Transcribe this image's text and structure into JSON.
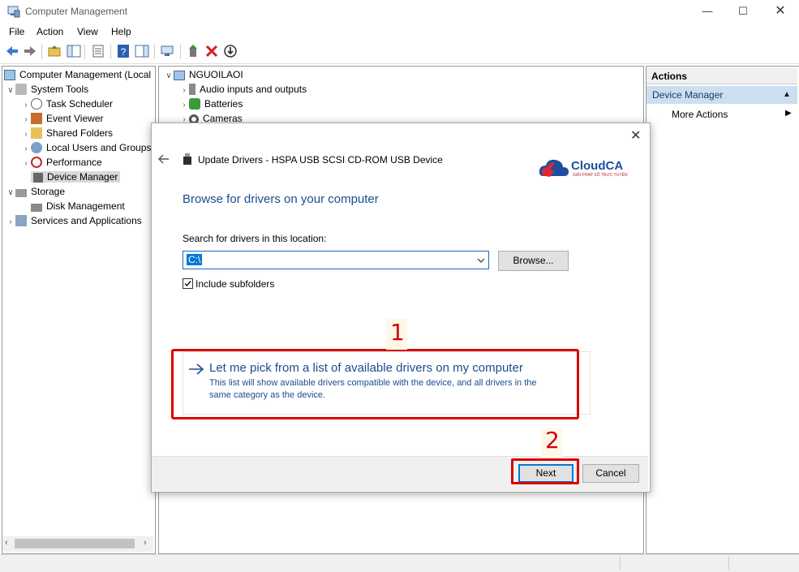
{
  "window": {
    "title": "Computer Management"
  },
  "menu": [
    "File",
    "Action",
    "View",
    "Help"
  ],
  "tree": [
    {
      "label": "Computer Management (Local",
      "expander": "",
      "icon": "computer-icon"
    },
    {
      "label": "System Tools",
      "expander": "∨",
      "icon": "tools-icon"
    },
    {
      "label": "Task Scheduler",
      "expander": "›",
      "icon": "clock-icon"
    },
    {
      "label": "Event Viewer",
      "expander": "›",
      "icon": "event-icon"
    },
    {
      "label": "Shared Folders",
      "expander": "›",
      "icon": "folder-icon"
    },
    {
      "label": "Local Users and Groups",
      "expander": "›",
      "icon": "users-icon"
    },
    {
      "label": "Performance",
      "expander": "›",
      "icon": "performance-icon"
    },
    {
      "label": "Device Manager",
      "expander": "",
      "icon": "device-manager-icon"
    },
    {
      "label": "Storage",
      "expander": "∨",
      "icon": "storage-icon"
    },
    {
      "label": "Disk Management",
      "expander": "",
      "icon": "disk-icon"
    },
    {
      "label": "Services and Applications",
      "expander": "›",
      "icon": "services-icon"
    }
  ],
  "devices": {
    "computer": "NGUOILAOI",
    "items": [
      "Audio inputs and outputs",
      "Batteries",
      "Cameras"
    ]
  },
  "actions": {
    "header": "Actions",
    "section": "Device Manager",
    "more": "More Actions"
  },
  "dialog": {
    "title": "Update Drivers - HSPA USB SCSI CD-ROM USB Device",
    "heading": "Browse for drivers on your computer",
    "search_label": "Search for drivers in this location:",
    "path_value": "C:\\",
    "browse_label": "Browse...",
    "include_subfolders": "Include subfolders",
    "pick_title": "Let me pick from a list of available drivers on my computer",
    "pick_desc_1": "This list will show available drivers compatible with the device, and all drivers in the",
    "pick_desc_2": "same category as the device.",
    "next_label": "Next",
    "cancel_label": "Cancel",
    "logo_name": "CloudCA",
    "logo_tagline": "GIẢI PHÁP SỐ TRỰC TUYẾN"
  },
  "annotations": {
    "step1": "1",
    "step2": "2"
  },
  "colors": {
    "accent": "#1a5fa8",
    "highlight": "#d90000",
    "logo_red": "#e3262e",
    "logo_blue": "#1d4e9e"
  }
}
